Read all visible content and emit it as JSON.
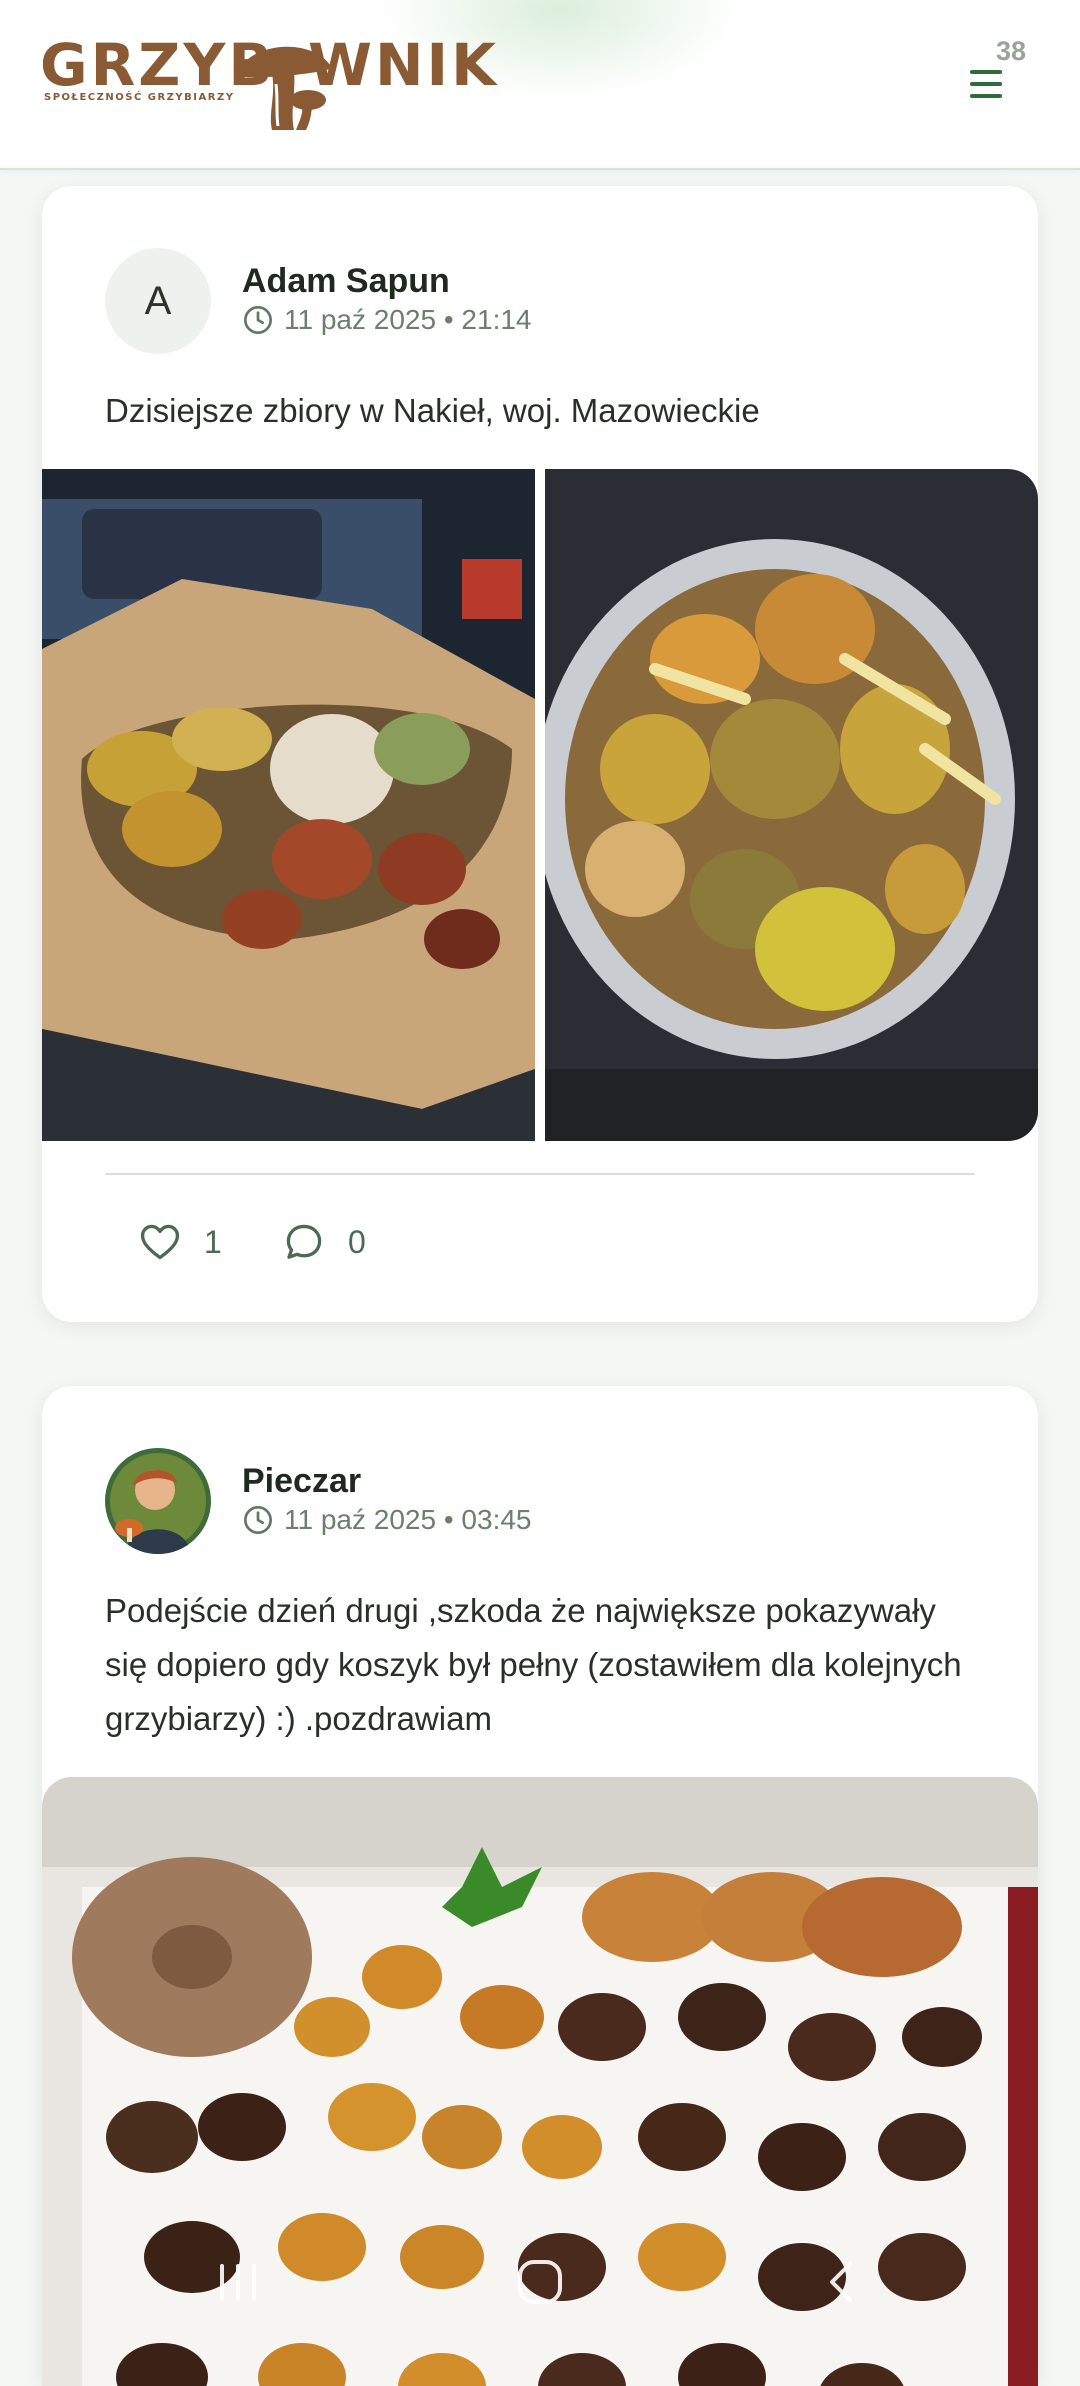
{
  "header": {
    "logo_left": "GRZYB",
    "logo_right": "WNIK",
    "logo_tagline": "SPOŁECZNOŚĆ GRZYBIARZY",
    "menu_badge": "38",
    "menu_icon": "hamburger-menu-icon",
    "brand_color": "#8a5a35",
    "accent_color": "#2f6a3a"
  },
  "posts": [
    {
      "avatar_letter": "A",
      "author": "Adam Sapun",
      "date": "11 paź 2025 • 21:14",
      "text": "Dzisiejsze zbiory w Nakieł, woj. Mazowieckie",
      "images": [
        "photo of mushrooms in a paper bag",
        "photo of mushrooms in a bucket"
      ],
      "likes": "1",
      "comments": "0"
    },
    {
      "avatar": "illustrated avatar",
      "author": "Pieczar",
      "date": "11 paź 2025 • 03:45",
      "text": "Podejście dzień drugi ,szkoda że największe pokazywały się dopiero gdy koszyk był pełny (zostawiłem dla kolejnych grzybiarzy) :) .pozdrawiam",
      "images": [
        "photo of mushrooms laid out on a table"
      ]
    }
  ],
  "system_nav": {
    "recent": "recent-apps-icon",
    "home": "home-icon",
    "back": "back-icon"
  }
}
